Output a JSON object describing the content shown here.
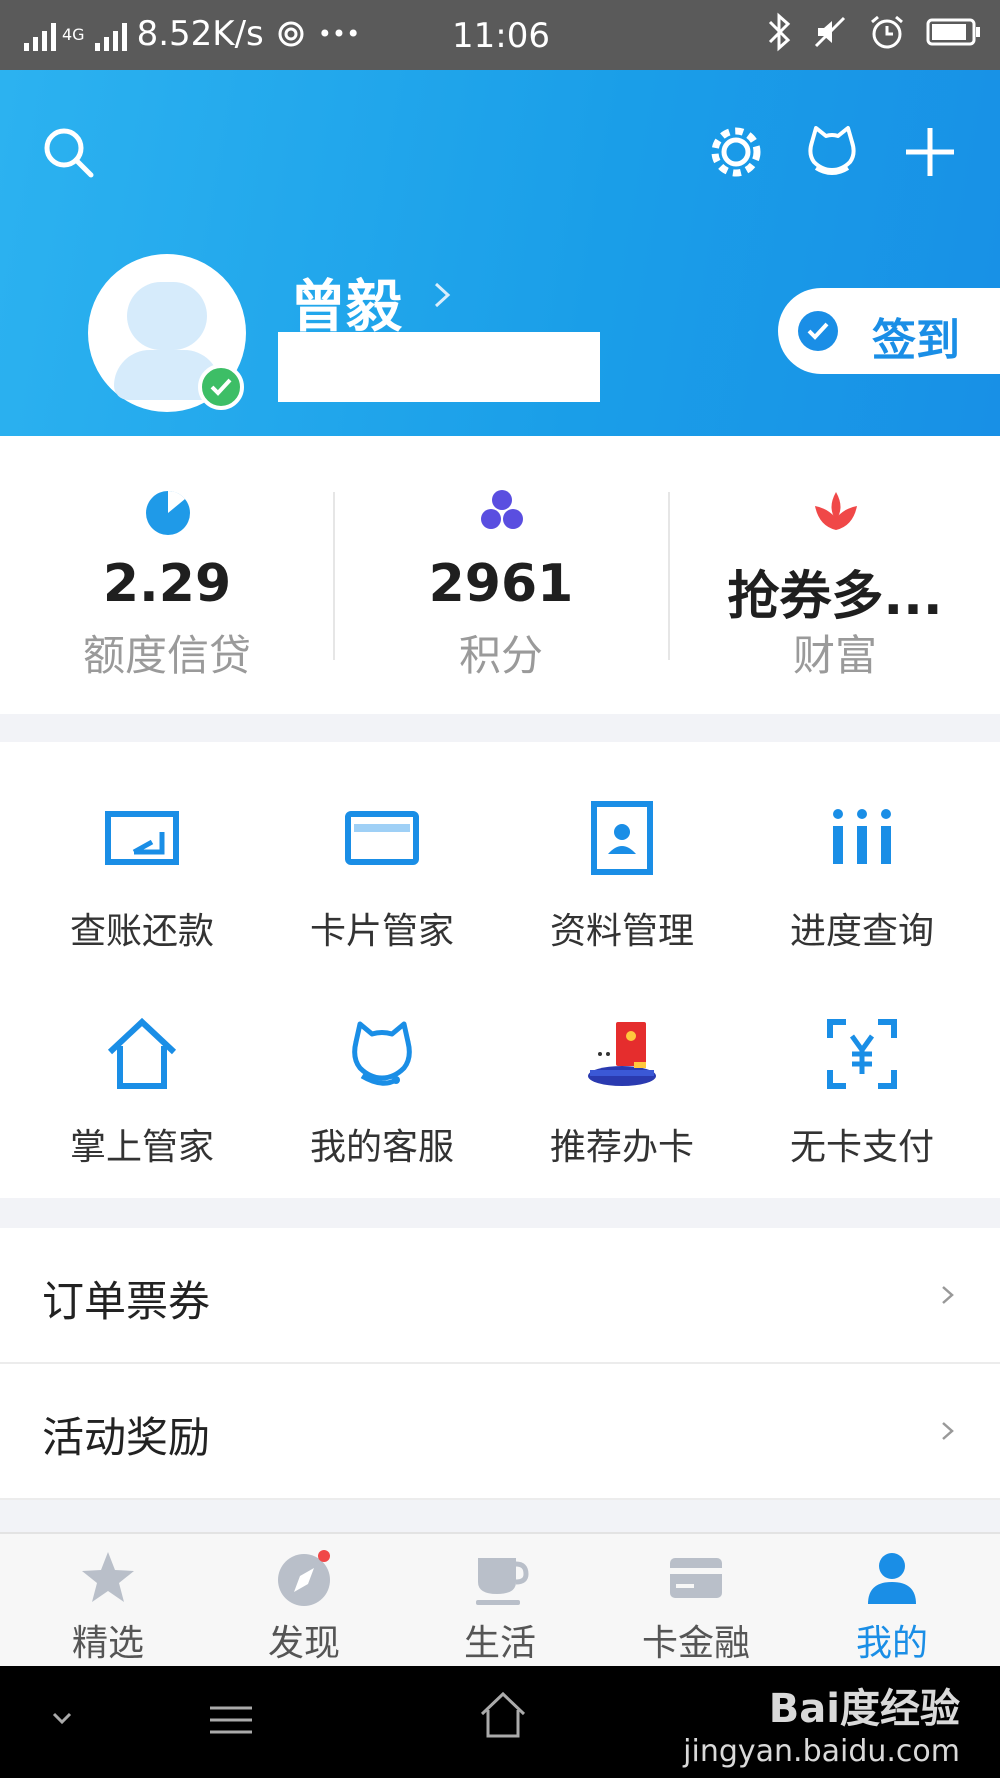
{
  "status_bar": {
    "net_label": "4G",
    "speed": "8.52K/s",
    "dots": "•••",
    "time": "11:06"
  },
  "header": {
    "user_name": "曾毅",
    "signin_label": "签到"
  },
  "stats": [
    {
      "value": "2.29",
      "label": "额度信贷"
    },
    {
      "value": "2961",
      "label": "积分"
    },
    {
      "value": "抢券多...",
      "label": "财富"
    }
  ],
  "grid": {
    "items": [
      {
        "label": "查账还款"
      },
      {
        "label": "卡片管家"
      },
      {
        "label": "资料管理"
      },
      {
        "label": "进度查询"
      },
      {
        "label": "掌上管家"
      },
      {
        "label": "我的客服"
      },
      {
        "label": "推荐办卡"
      },
      {
        "label": "无卡支付"
      }
    ]
  },
  "list": [
    {
      "label": "订单票券"
    },
    {
      "label": "活动奖励"
    }
  ],
  "tabs": [
    {
      "label": "精选"
    },
    {
      "label": "发现"
    },
    {
      "label": "生活"
    },
    {
      "label": "卡金融"
    },
    {
      "label": "我的"
    }
  ],
  "watermark": {
    "brand": "Bai度经验",
    "url": "jingyan.baidu.com"
  },
  "colors": {
    "accent": "#1a8ee6",
    "header_start": "#2cb2f0",
    "verify_green": "#3dbe66",
    "wealth_red": "#f04848",
    "points_purple": "#5a4ee0"
  }
}
